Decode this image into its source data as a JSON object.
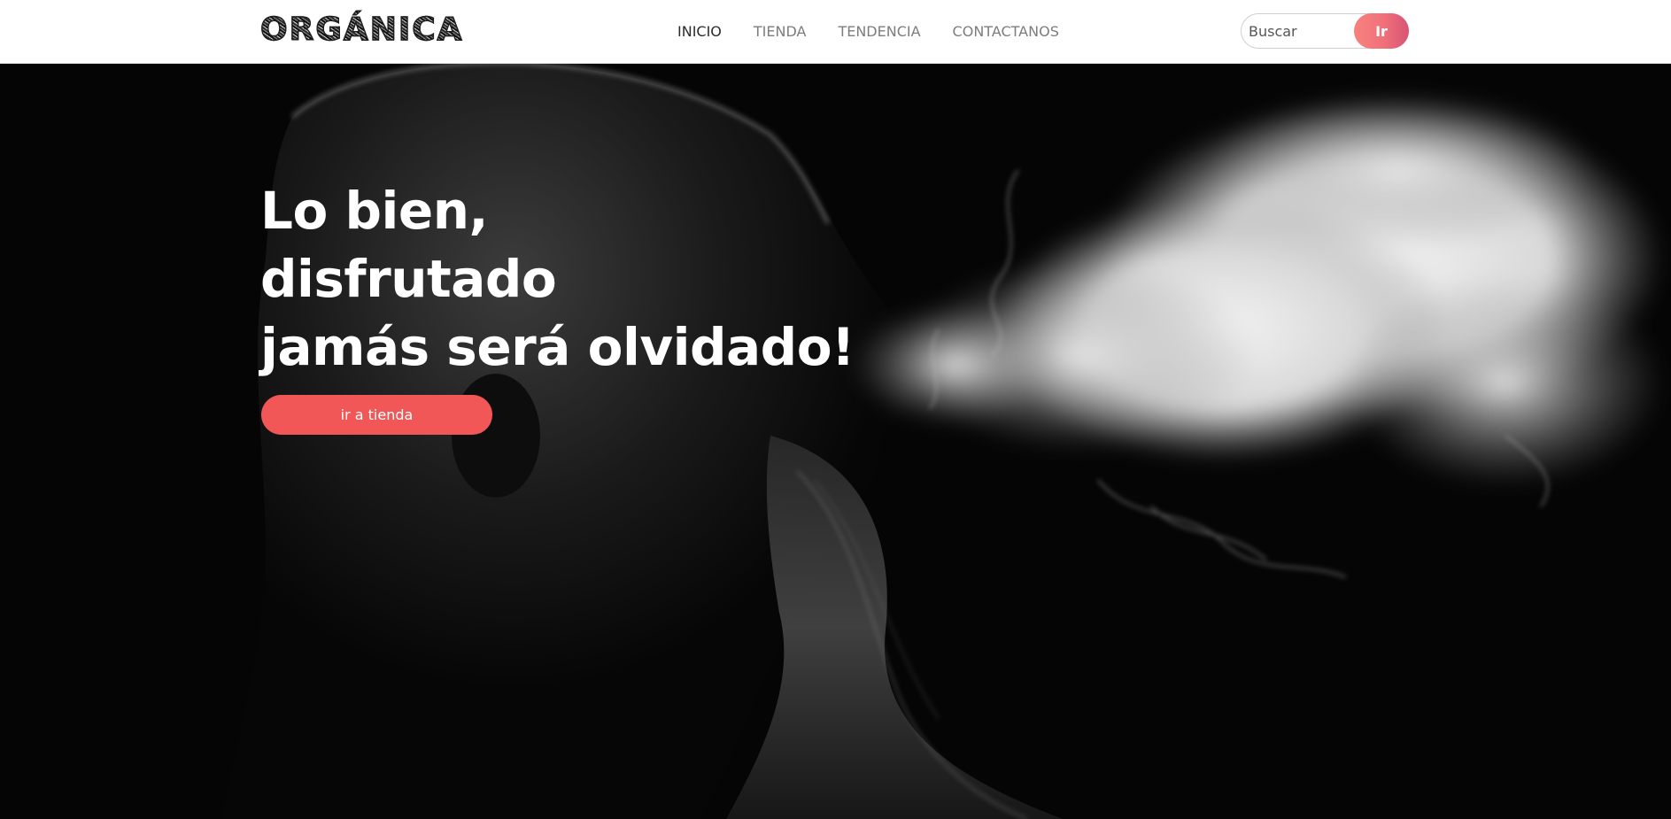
{
  "brand": {
    "logo_text": "ORGÁNICA"
  },
  "nav": {
    "items": [
      {
        "label": "INICIO",
        "active": true
      },
      {
        "label": "TIENDA",
        "active": false
      },
      {
        "label": "TENDENCIA",
        "active": false
      },
      {
        "label": "CONTACTANOS",
        "active": false
      }
    ]
  },
  "search": {
    "placeholder": "Buscar",
    "value": "",
    "button_label": "Ir"
  },
  "hero": {
    "title_lines": [
      "Lo bien,",
      "disfrutado",
      "jamás será olvidado!"
    ],
    "cta_label": "ir a tienda",
    "background_image": "bearded-man-exhaling-smoke-black-and-white"
  },
  "colors": {
    "accent": "#f15757",
    "search_button_gradient": [
      "#f7827d",
      "#d85473"
    ],
    "nav_active": "#2b2b2b",
    "nav_inactive": "#7d7d7d",
    "hero_background": "#050505"
  }
}
